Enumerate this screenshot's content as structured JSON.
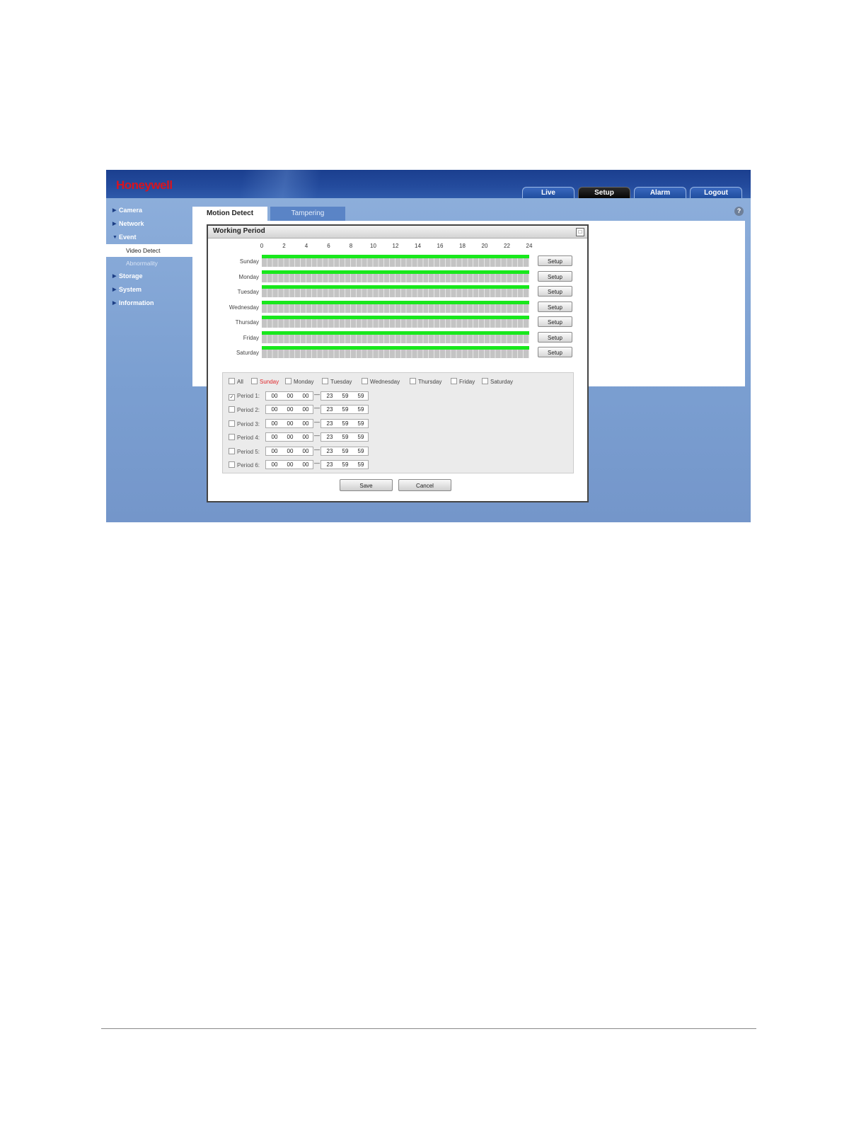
{
  "brand": {
    "logo": "Honeywell",
    "logo_color": "#d8141f"
  },
  "topnav": [
    {
      "label": "Live",
      "active": false
    },
    {
      "label": "Setup",
      "active": true
    },
    {
      "label": "Alarm",
      "active": false
    },
    {
      "label": "Logout",
      "active": false
    }
  ],
  "sidebar": {
    "items": [
      {
        "label": "Camera",
        "arrow": "▶"
      },
      {
        "label": "Network",
        "arrow": "▶"
      },
      {
        "label": "Event",
        "arrow": "▼"
      }
    ],
    "subitems": [
      {
        "label": "Video Detect",
        "active": true
      },
      {
        "label": "Abnormality",
        "active": false
      }
    ],
    "items_after": [
      {
        "label": "Storage",
        "arrow": "▶"
      },
      {
        "label": "System",
        "arrow": "▶"
      },
      {
        "label": "Information",
        "arrow": "▶"
      }
    ]
  },
  "tabs": [
    {
      "label": "Motion Detect",
      "active": true
    },
    {
      "label": "Tampering",
      "active": false
    }
  ],
  "help_icon": "?",
  "dialog": {
    "title": "Working Period",
    "close_icon": "□",
    "hours": [
      "0",
      "2",
      "4",
      "6",
      "8",
      "10",
      "12",
      "14",
      "16",
      "18",
      "20",
      "22",
      "24"
    ],
    "days": [
      {
        "label": "Sunday",
        "coverage": 1.0
      },
      {
        "label": "Monday",
        "coverage": 1.0
      },
      {
        "label": "Tuesday",
        "coverage": 1.0
      },
      {
        "label": "Wednesday",
        "coverage": 1.0
      },
      {
        "label": "Thursday",
        "coverage": 1.0
      },
      {
        "label": "Friday",
        "coverage": 1.0
      },
      {
        "label": "Saturday",
        "coverage": 1.0
      }
    ],
    "setup_label": "Setup",
    "day_options": [
      {
        "label": "All",
        "checked": false,
        "highlight": false
      },
      {
        "label": "Sunday",
        "checked": false,
        "highlight": true
      },
      {
        "label": "Monday",
        "checked": false,
        "highlight": false
      },
      {
        "label": "Tuesday",
        "checked": false,
        "highlight": false
      },
      {
        "label": "Wednesday",
        "checked": false,
        "highlight": false
      },
      {
        "label": "Thursday",
        "checked": false,
        "highlight": false
      },
      {
        "label": "Friday",
        "checked": false,
        "highlight": false
      },
      {
        "label": "Saturday",
        "checked": false,
        "highlight": false
      }
    ],
    "periods": [
      {
        "label": "Period 1:",
        "checked": true,
        "start": [
          "00",
          "00",
          "00"
        ],
        "end": [
          "23",
          "59",
          "59"
        ]
      },
      {
        "label": "Period 2:",
        "checked": false,
        "start": [
          "00",
          "00",
          "00"
        ],
        "end": [
          "23",
          "59",
          "59"
        ]
      },
      {
        "label": "Period 3:",
        "checked": false,
        "start": [
          "00",
          "00",
          "00"
        ],
        "end": [
          "23",
          "59",
          "59"
        ]
      },
      {
        "label": "Period 4:",
        "checked": false,
        "start": [
          "00",
          "00",
          "00"
        ],
        "end": [
          "23",
          "59",
          "59"
        ]
      },
      {
        "label": "Period 5:",
        "checked": false,
        "start": [
          "00",
          "00",
          "00"
        ],
        "end": [
          "23",
          "59",
          "59"
        ]
      },
      {
        "label": "Period 6:",
        "checked": false,
        "start": [
          "00",
          "00",
          "00"
        ],
        "end": [
          "23",
          "59",
          "59"
        ]
      }
    ],
    "period_separator": "—",
    "save_label": "Save",
    "cancel_label": "Cancel"
  },
  "colors": {
    "active_bar": "#18e81c",
    "sunday_label": "#e0262a"
  }
}
